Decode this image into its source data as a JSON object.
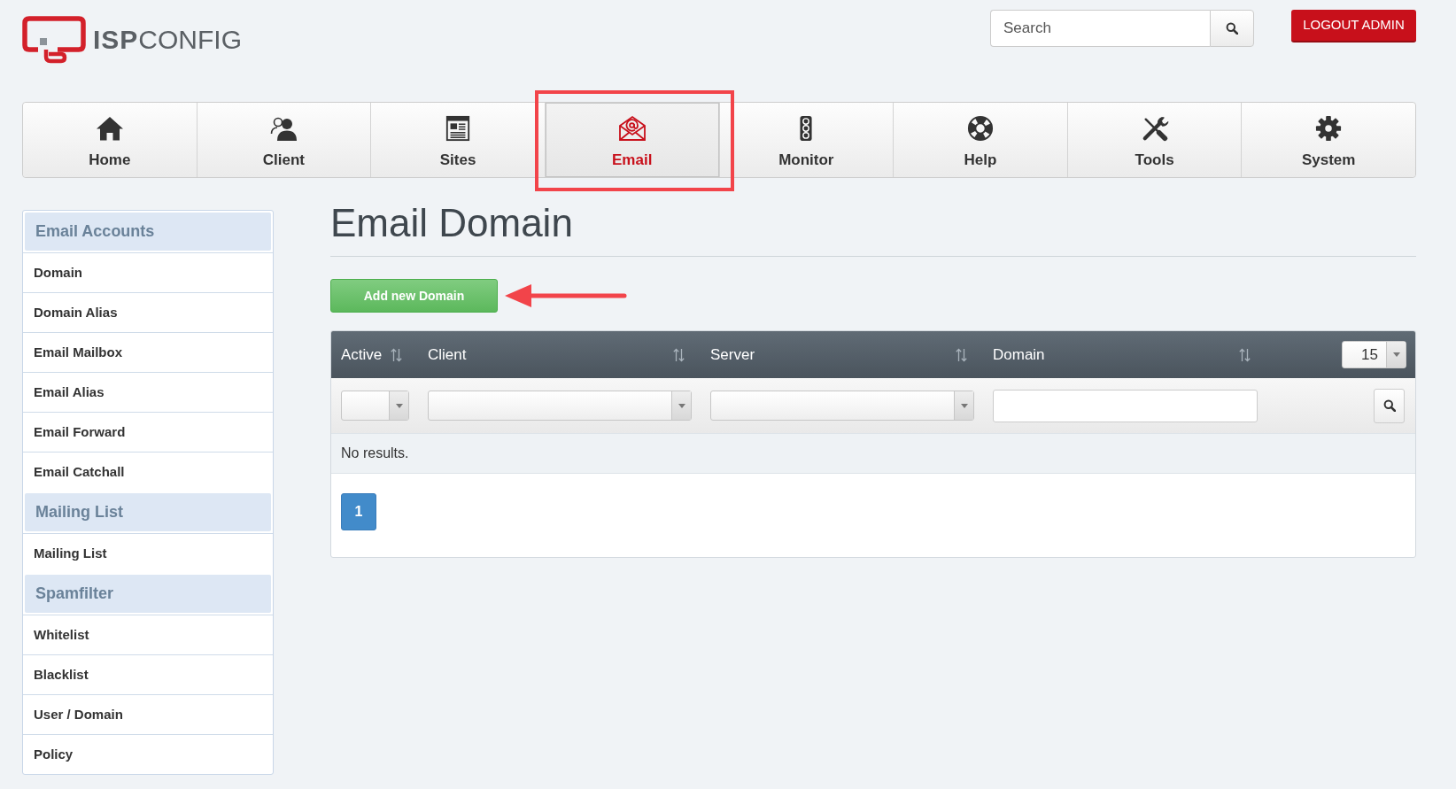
{
  "header": {
    "logo_text": "**ISP**CONFIG",
    "search": {
      "placeholder": "Search"
    },
    "logout_button": "LOGOUT ADMIN"
  },
  "nav_tabs": [
    {
      "label": "Home",
      "selected": false,
      "highlighted": false
    },
    {
      "label": "Client",
      "selected": false,
      "highlighted": false
    },
    {
      "label": "Sites",
      "selected": false,
      "highlighted": false
    },
    {
      "label": "Email",
      "selected": true,
      "highlighted": true
    },
    {
      "label": "Monitor",
      "selected": false,
      "highlighted": false
    },
    {
      "label": "Help",
      "selected": false,
      "highlighted": false
    },
    {
      "label": "Tools",
      "selected": false,
      "highlighted": false
    },
    {
      "label": "System",
      "selected": false,
      "highlighted": false
    }
  ],
  "sidebar": [
    {
      "title": "Email Accounts",
      "items": [
        "Domain",
        "Domain Alias",
        "Email Mailbox",
        "Email Alias",
        "Email Forward",
        "Email Catchall"
      ]
    },
    {
      "title": "Mailing List",
      "items": [
        "Mailing List"
      ]
    },
    {
      "title": "Spamfilter",
      "items": [
        "Whitelist",
        "Blacklist",
        "User / Domain",
        "Policy"
      ]
    }
  ],
  "page": {
    "title": "Email Domain",
    "add_button": {
      "label": "Add new Domain",
      "pointer_arrow": true
    }
  },
  "table": {
    "columns": [
      {
        "label": "Active",
        "sortable": true,
        "kind": "select"
      },
      {
        "label": "Client",
        "sortable": true,
        "kind": "select"
      },
      {
        "label": "Server",
        "sortable": true,
        "kind": "select"
      },
      {
        "label": "Domain",
        "sortable": true,
        "kind": "text"
      }
    ],
    "page_size": "15",
    "empty_message": "No results.",
    "pagination": [
      {
        "label": "1",
        "selected": true
      }
    ]
  }
}
